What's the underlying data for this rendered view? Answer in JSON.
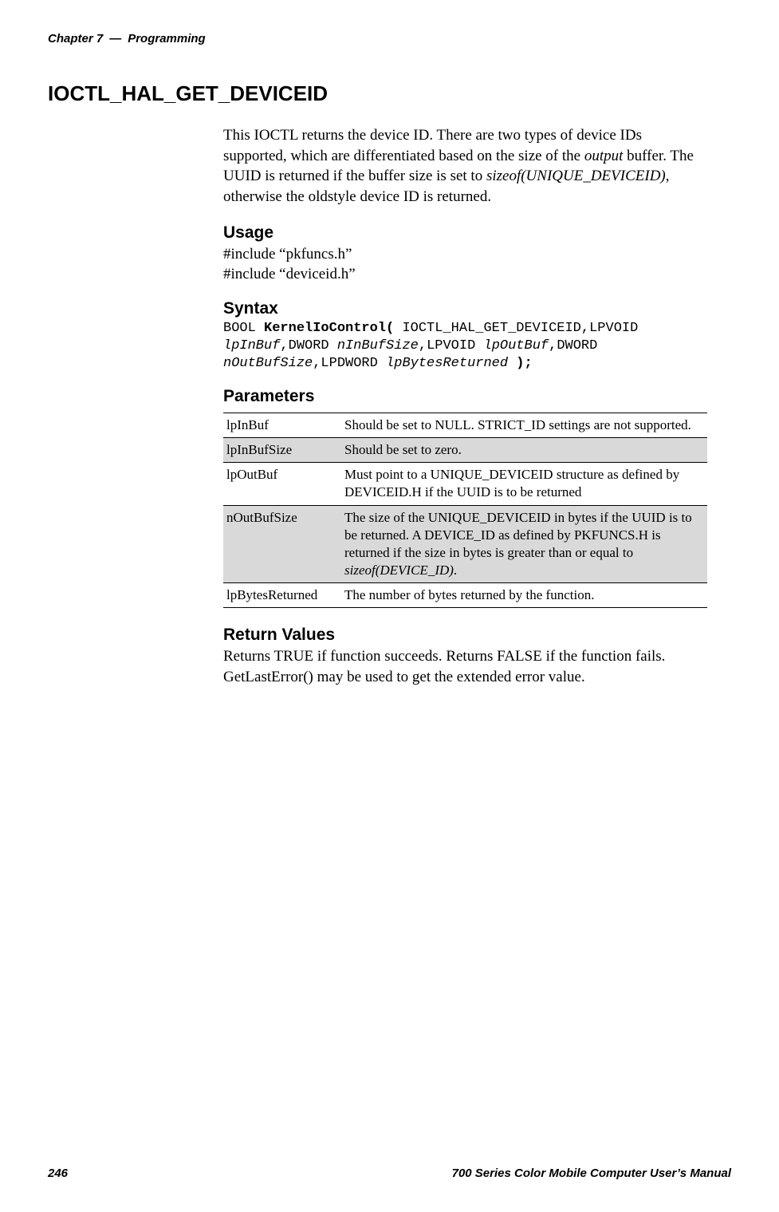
{
  "header": {
    "chapter": "Chapter 7",
    "dash": "—",
    "section": "Programming"
  },
  "main_heading": "IOCTL_HAL_GET_DEVICEID",
  "intro": {
    "line1": "This IOCTL returns the device ID. There are two types of device IDs supported, which are differentiated based on the size of the ",
    "output_word": "output",
    "line2": " buffer. The UUID is returned if the buffer size is set to ",
    "sizeof_expr": "sizeof(UNIQUE_DEVICEID)",
    "line3": ", otherwise the oldstyle device ID is returned."
  },
  "usage": {
    "heading": "Usage",
    "include1": "#include “pkfuncs.h”",
    "include2": "#include “deviceid.h”"
  },
  "syntax": {
    "heading": "Syntax",
    "type1": "BOOL ",
    "fn": "KernelIoControl(",
    "arg1_plain": " IOCTL_HAL_GET_DEVICEID,LPVOID ",
    "arg2_italic": "lpInBuf",
    "arg3_plain": ",DWORD ",
    "arg4_italic": "nInBufSize",
    "arg5_plain": ",LPVOID ",
    "arg6_italic": "lpOutBuf",
    "arg7_plain": ",DWORD ",
    "arg8_italic": "nOutBufSize",
    "arg9_plain": ",LPDWORD ",
    "arg10_italic": "lpBytesReturned",
    "close": " );"
  },
  "parameters": {
    "heading": "Parameters",
    "rows": [
      {
        "name": "lpInBuf",
        "desc": "Should be set to NULL. STRICT_ID settings are not supported."
      },
      {
        "name": "lpInBufSize",
        "desc": "Should be set to zero."
      },
      {
        "name": "lpOutBuf",
        "desc": "Must point to a UNIQUE_DEVICEID structure as defined by DEVICEID.H if the UUID is to be returned"
      },
      {
        "name": "nOutBufSize",
        "desc_pre": "The size of the UNIQUE_DEVICEID in bytes if the UUID is to be returned. A DEVICE_ID as defined by PKFUNCS.H is returned if the size in bytes is greater than or equal to ",
        "desc_italic": "sizeof(DEVICE_ID)",
        "desc_post": "."
      },
      {
        "name": "lpBytesReturned",
        "desc": "The number of bytes returned by the function."
      }
    ]
  },
  "return_values": {
    "heading": "Return Values",
    "text": "Returns TRUE if function succeeds. Returns FALSE if the function fails. GetLastError() may be used to get the extended error value."
  },
  "footer": {
    "page": "246",
    "title": "700 Series Color Mobile Computer User’s Manual"
  }
}
